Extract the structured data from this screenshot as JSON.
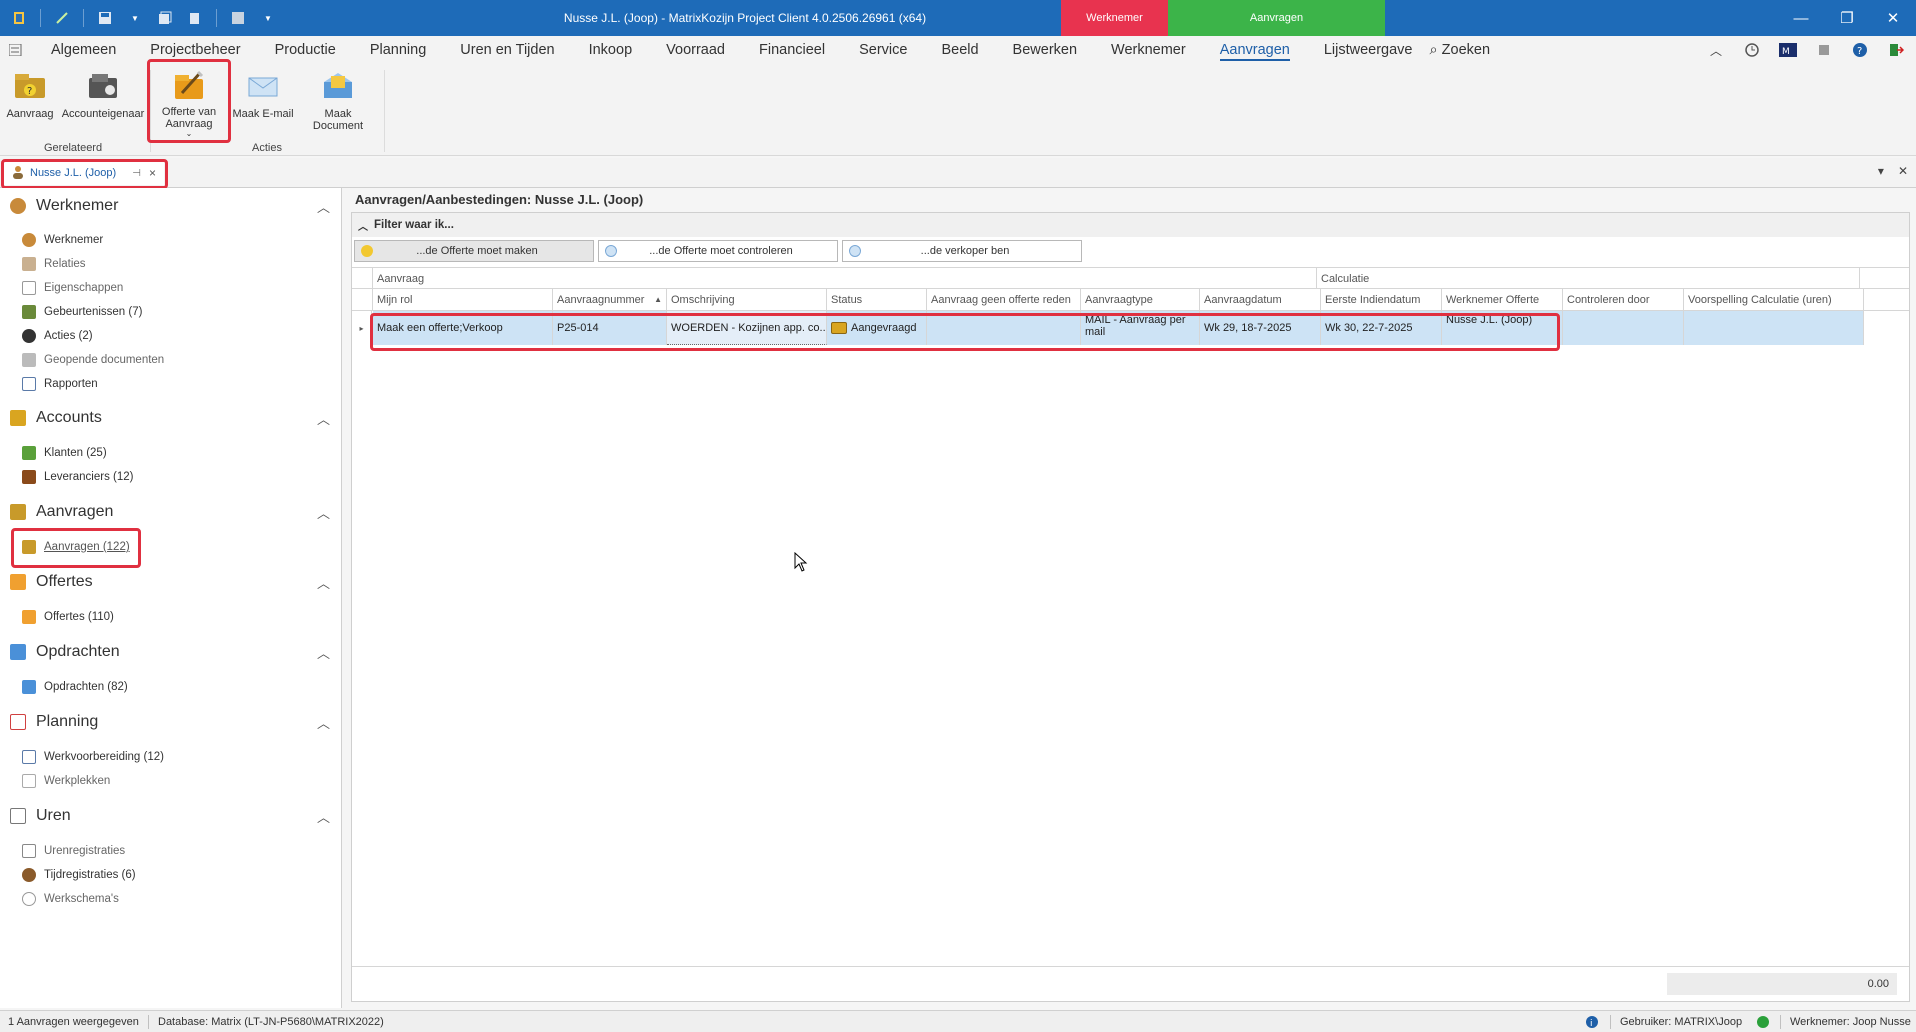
{
  "window": {
    "title": "Nusse J.L. (Joop) - MatrixKozijn Project Client 4.0.2506.26961 (x64)",
    "context_tab_red": "Werknemer",
    "context_tab_green": "Aanvragen",
    "minimize": "—",
    "maximize": "❐",
    "close": "✕"
  },
  "menu": {
    "items": [
      "Algemeen",
      "Projectbeheer",
      "Productie",
      "Planning",
      "Uren en Tijden",
      "Inkoop",
      "Voorraad",
      "Financieel",
      "Service",
      "Beeld",
      "Bewerken",
      "Werknemer",
      "Aanvragen",
      "Lijstweergave"
    ],
    "search": "Zoeken"
  },
  "ribbon": {
    "aanvraag": "Aanvraag",
    "accounteigenaar": "Accounteigenaar",
    "offerte_line1": "Offerte van",
    "offerte_line2": "Aanvraag",
    "maak_email": "Maak E-mail",
    "maak_document": "Maak Document",
    "group_gerelateerd": "Gerelateerd",
    "group_acties": "Acties"
  },
  "doctab": {
    "label": "Nusse J.L. (Joop)"
  },
  "sidebar": {
    "werknemer": {
      "title": "Werknemer",
      "items": [
        "Werknemer",
        "Relaties",
        "Eigenschappen",
        "Gebeurtenissen (7)",
        "Acties (2)",
        "Geopende documenten",
        "Rapporten"
      ]
    },
    "accounts": {
      "title": "Accounts",
      "items": [
        "Klanten (25)",
        "Leveranciers (12)"
      ]
    },
    "aanvragen": {
      "title": "Aanvragen",
      "items": [
        "Aanvragen (122)"
      ]
    },
    "offertes": {
      "title": "Offertes",
      "items": [
        "Offertes (110)"
      ]
    },
    "opdrachten": {
      "title": "Opdrachten",
      "items": [
        "Opdrachten (82)"
      ]
    },
    "planning": {
      "title": "Planning",
      "items": [
        "Werkvoorbereiding (12)",
        "Werkplekken"
      ]
    },
    "uren": {
      "title": "Uren",
      "items": [
        "Urenregistraties",
        "Tijdregistraties (6)",
        "Werkschema's"
      ]
    }
  },
  "main": {
    "title": "Aanvragen/Aanbestedingen: Nusse J.L. (Joop)",
    "filter_title": "Filter waar ik...",
    "filters": [
      "...de Offerte moet maken",
      "...de Offerte moet controleren",
      "...de verkoper ben"
    ],
    "bands": [
      "Aanvraag",
      "Calculatie"
    ],
    "columns": [
      "Mijn rol",
      "Aanvraagnummer",
      "Omschrijving",
      "Status",
      "Aanvraag geen offerte reden",
      "Aanvraagtype",
      "Aanvraagdatum",
      "Eerste Indiendatum",
      "Werknemer Offerte",
      "Controleren door",
      "Voorspelling Calculatie (uren)"
    ],
    "rows": [
      {
        "mijn_rol": "Maak een offerte;Verkoop",
        "aanvraagnummer": "P25-014",
        "omschrijving": "WOERDEN - Kozijnen app. co...",
        "status": "Aangevraagd",
        "geen_offerte_reden": "",
        "aanvraagtype": "MAIL - Aanvraag per mail",
        "aanvraagdatum": "Wk 29, 18-7-2025",
        "eerste_indiendatum": "Wk 30, 22-7-2025",
        "werknemer_offerte": "Nusse J.L. (Joop)",
        "controleren_door": "",
        "voorspelling": ""
      }
    ],
    "total": "0.00"
  },
  "statusbar": {
    "count": "1 Aanvragen weergegeven",
    "database": "Database: Matrix (LT-JN-P5680\\MATRIX2022)",
    "gebruiker": "Gebruiker: MATRIX\\Joop",
    "werknemer": "Werknemer: Joop Nusse"
  },
  "colors": {
    "titlebar": "#1e6bb8",
    "context_red": "#e8334f",
    "context_green": "#3cb449",
    "selected_row": "#cde3f5",
    "highlight": "#e03040"
  }
}
